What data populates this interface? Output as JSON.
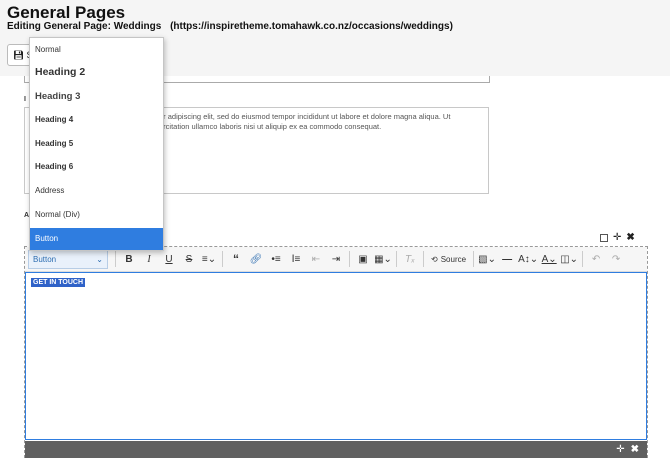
{
  "page": {
    "title": "General Pages",
    "subtitle": "Editing General Page: Weddings",
    "url": "(https://inspiretheme.tomahawk.co.nz/occasions/weddings)"
  },
  "toolbar": {
    "save_label": "S"
  },
  "form": {
    "intro_label": "I",
    "intro_text": "ur adipiscing elit, sed do eiusmod tempor incididunt ut labore et dolore magna aliqua. Ut\nercitation ullamco laboris nisi ut aliquip ex ea commodo consequat.",
    "intro_prefix": "*",
    "block_label": "A"
  },
  "editor": {
    "style_select": "Button",
    "source_label": "Source",
    "content_text": "GET IN TOUCH"
  },
  "style_dropdown": {
    "items": [
      {
        "label": "Normal"
      },
      {
        "label": "Heading 2"
      },
      {
        "label": "Heading 3"
      },
      {
        "label": "Heading 4"
      },
      {
        "label": "Heading 5"
      },
      {
        "label": "Heading 6"
      },
      {
        "label": "Address"
      },
      {
        "label": "Normal (Div)"
      },
      {
        "label": "Button",
        "selected": true
      }
    ]
  },
  "colors": {
    "accent": "#2f7de0",
    "footer": "#606060"
  },
  "icons": [
    "save-icon",
    "move-icon",
    "close-icon",
    "bold-icon",
    "italic-icon",
    "underline-icon",
    "strikethrough-icon",
    "align-icon",
    "blockquote-icon",
    "link-icon",
    "bulleted-list-icon",
    "numbered-list-icon",
    "outdent-icon",
    "indent-icon",
    "media-icon",
    "table-icon",
    "remove-format-icon",
    "source-icon",
    "template-icon",
    "horizontal-line-icon",
    "font-size-icon",
    "font-color-icon",
    "layout-icon",
    "undo-icon",
    "redo-icon"
  ]
}
